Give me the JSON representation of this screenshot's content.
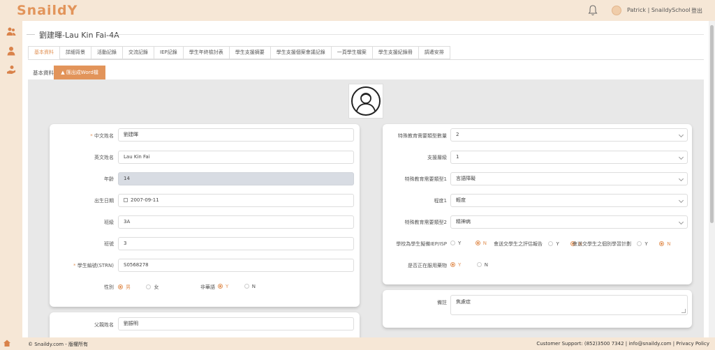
{
  "header": {
    "logo": "SnaildY",
    "user": "Patrick | SnaildySchool",
    "logout": "登出"
  },
  "page": {
    "title": "劉建暉-Lau Kin Fai-4A"
  },
  "tabs": [
    {
      "label": "基本資料"
    },
    {
      "label": "詳細背景"
    },
    {
      "label": "活動記錄"
    },
    {
      "label": "交流記錄"
    },
    {
      "label": "IEP記錄"
    },
    {
      "label": "學生年終檢討表"
    },
    {
      "label": "學生支援摘要"
    },
    {
      "label": "學生支援個案會議記錄"
    },
    {
      "label": "一頁學生檔案"
    },
    {
      "label": "學生支援紀錄冊"
    },
    {
      "label": "調遣安排"
    }
  ],
  "subtab": {
    "label": "基本資料",
    "export_button": "匯出成Word檔"
  },
  "left_form": {
    "chinese_name": {
      "label": "中文姓名",
      "value": "劉建暉"
    },
    "english_name": {
      "label": "英文姓名",
      "value": "Lau Kin Fai"
    },
    "age": {
      "label": "年齡",
      "value": "14"
    },
    "dob": {
      "label": "出生日期",
      "value": "2007-09-11"
    },
    "class": {
      "label": "班級",
      "value": "3A"
    },
    "class_no": {
      "label": "班號",
      "value": "3"
    },
    "strn": {
      "label": "學生編號(STRN)",
      "value": "S0568278"
    },
    "gender": {
      "label": "性別",
      "option_male": "男",
      "option_female": "女",
      "selected": "男"
    },
    "non_chinese": {
      "label": "非華語",
      "option_yes": "Y",
      "option_no": "N",
      "selected": "Y"
    }
  },
  "parent_form": {
    "father_name": {
      "label": "父親姓名",
      "value": "劉振明"
    }
  },
  "right_form": {
    "sen_count": {
      "label": "特殊教育需要類型數量",
      "value": "2"
    },
    "support_level": {
      "label": "支援層級",
      "value": "1"
    },
    "sen_type1": {
      "label": "特殊教育需要類型1",
      "value": "言語障礙"
    },
    "degree1": {
      "label": "程度1",
      "value": "輕度"
    },
    "sen_type2": {
      "label": "特殊教育需要類型2",
      "value": "精神病"
    },
    "iep_q": {
      "label": "學校為學生擬備IEP/ISP",
      "yes": "Y",
      "no": "N",
      "selected": "N"
    },
    "assess_q": {
      "label": "會送交學生之評估報告",
      "yes": "Y",
      "no": "N",
      "selected": "N"
    },
    "plan_q": {
      "label": "會送交學生之個別學習計劃",
      "yes": "Y",
      "no": "N",
      "selected": "N"
    },
    "medication": {
      "label": "是否正在服用藥物",
      "yes": "Y",
      "no": "N",
      "selected": "Y"
    }
  },
  "remarks": {
    "label": "備註",
    "value": "焦慮症"
  },
  "footer": {
    "copyright": "© Snaildy.com - 版權所有",
    "support": "Customer Support: (852)3500 7342 | info@snaildy.com | Privacy Policy"
  },
  "colors": {
    "accent": "#e2945a",
    "header_bg": "#f6e7d6",
    "content_bg": "#e8e8e8"
  }
}
